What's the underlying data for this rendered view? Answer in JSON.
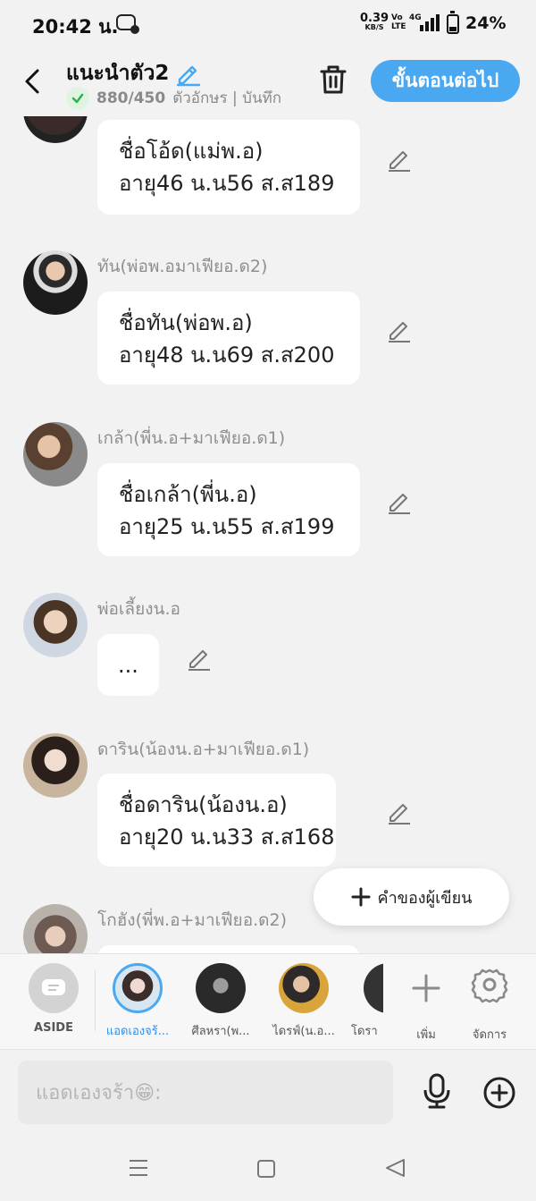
{
  "status_bar": {
    "time": "20:42 น.",
    "speed_value": "0.39",
    "speed_unit": "KB/S",
    "volte": "Vo LTE",
    "network": "4G",
    "battery": "24%"
  },
  "header": {
    "title": "แนะนำตัว2",
    "char_count": "880/450",
    "subtitle": "ตัวอักษร | บันทึก",
    "next_label": "ขั้นตอนต่อไป"
  },
  "messages": [
    {
      "name": "",
      "lines": [
        "ชื่อโอ้ด(แม่พ.อ)",
        "อายุ46 น.น56 ส.ส189"
      ]
    },
    {
      "name": "ทัน(พ่อพ.อมาเฟียอ.ด2)",
      "lines": [
        "ชื่อทัน(พ่อพ.อ)",
        "อายุ48 น.น69 ส.ส200"
      ]
    },
    {
      "name": "เกล้า(พี่น.อ+มาเฟียอ.ด1)",
      "lines": [
        "ชื่อเกล้า(พี่น.อ)",
        "อายุ25 น.น55 ส.ส199"
      ]
    },
    {
      "name": "พ่อเลี้ยงน.อ",
      "lines": [
        "..."
      ]
    },
    {
      "name": "ดาริน(น้องน.อ+มาเฟียอ.ด1)",
      "lines": [
        "ชื่อดาริน(น้องน.อ)",
        "อายุ20 น.น33 ส.ส168"
      ]
    },
    {
      "name": "โกฮัง(พี่พ.อ+มาเฟียอ.ด2)",
      "lines": []
    }
  ],
  "author_note_label": "คำของผู้เขียน",
  "character_bar": {
    "aside_label": "ASIDE",
    "characters": [
      "แอดเองจร้...",
      "ศีลหรา(พ...",
      "ไดรฟ์(น.อ...",
      "โดรา"
    ],
    "add_label": "เพิ่ม",
    "manage_label": "จัดการ"
  },
  "input": {
    "placeholder": "แอดเองจร้า😁:"
  },
  "colors": {
    "accent": "#4aa8f1",
    "background": "#f2f2f2",
    "bubble": "#ffffff",
    "check_green": "#2fb24a"
  }
}
